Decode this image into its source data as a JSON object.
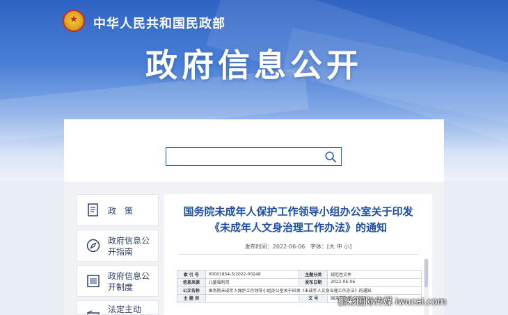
{
  "header": {
    "ministry_name": "中华人民共和国民政部",
    "banner_title": "政府信息公开"
  },
  "search": {
    "value": "",
    "placeholder": ""
  },
  "nav": {
    "items": [
      {
        "label": "政　策",
        "icon": "document-icon"
      },
      {
        "label": "政府信息公开指南",
        "icon": "compass-icon"
      },
      {
        "label": "政府信息公开制度",
        "icon": "list-icon"
      },
      {
        "label": "法定主动",
        "icon": "folder-icon"
      }
    ]
  },
  "article": {
    "title_line1": "国务院未成年人保护工作领导小组办公室关于印发",
    "title_line2": "《未成年人文身治理工作办法》的通知",
    "publish_label": "发布时间：",
    "publish_date": "2022-06-06",
    "font_label": "字体：",
    "font_sizes": "[大 中 小]"
  },
  "info_table": {
    "rows": [
      {
        "l1": "索 引 号",
        "v1": "00001854-5/2022-00248",
        "l2": "主题分类",
        "v2": "规范性文件"
      },
      {
        "l1": "信息来源",
        "v1": "儿童福利司",
        "l2": "发布日期",
        "v2": "2022-06-06"
      },
      {
        "l1": "公文名称",
        "v1": "国务院未成年人保护工作领导小组办公室关于印发《未成年人文身治理工作办法》的通知",
        "l2": "",
        "v2": ""
      },
      {
        "l1": "主 题 词",
        "v1": "",
        "l2": "文  号",
        "v2": "国未保办发〔2022"
      }
    ]
  },
  "watermark": "鹏彩国际传媒 iwucai.com"
}
